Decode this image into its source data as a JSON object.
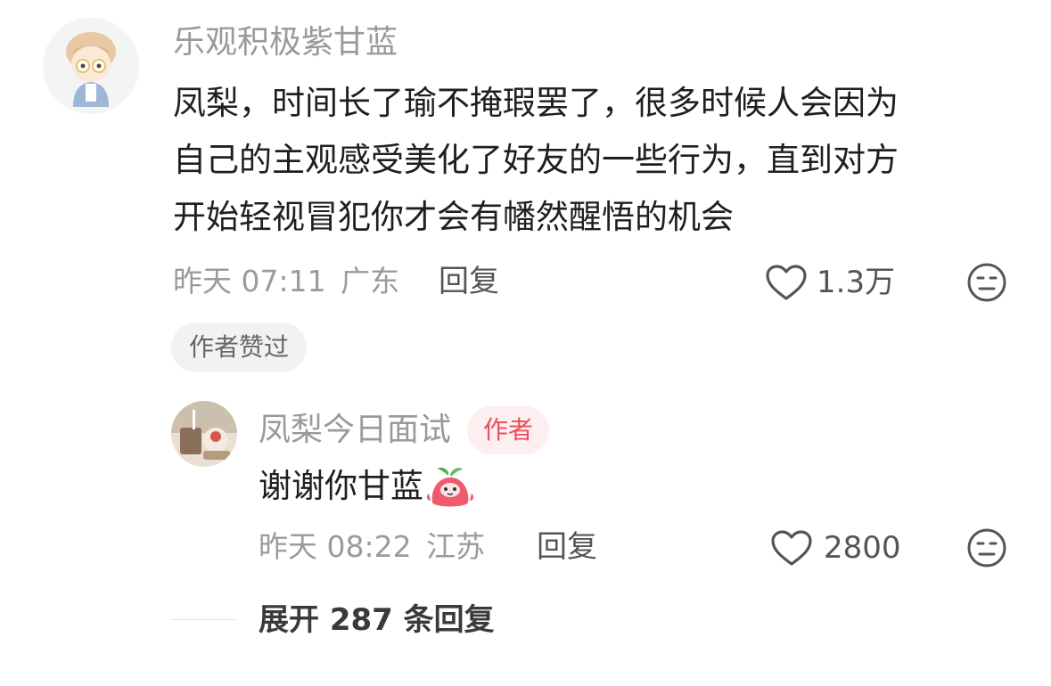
{
  "comment": {
    "username": "乐观积极紫甘蓝",
    "text_lines": [
      "凤梨，时间长了瑜不掩瑕罢了，很多时候人会因为",
      "自己的主观感受美化了好友的一些行为，直到对方",
      "开始轻视冒犯你才会有幡然醒悟的机会"
    ],
    "time": "昨天 07:11",
    "location": "广东",
    "reply_label": "回复",
    "like_count": "1.3万",
    "author_liked_tag": "作者赞过",
    "avatar_icon": "cartoon-avatar",
    "like_icon": "heart-outline-icon",
    "dislike_icon": "meh-face-icon"
  },
  "reply": {
    "username": "凤梨今日面试",
    "author_badge": "作者",
    "text": "谢谢你甘蓝",
    "emoji_icon": "cute-mascot-emoji",
    "time": "昨天 08:22",
    "location": "江苏",
    "reply_label": "回复",
    "like_count": "2800",
    "avatar_icon": "photo-avatar"
  },
  "expand": {
    "label": "展开 287 条回复"
  },
  "colors": {
    "accent_red": "#e8505b",
    "muted": "#9b9b9b",
    "text": "#1f1f1f"
  }
}
